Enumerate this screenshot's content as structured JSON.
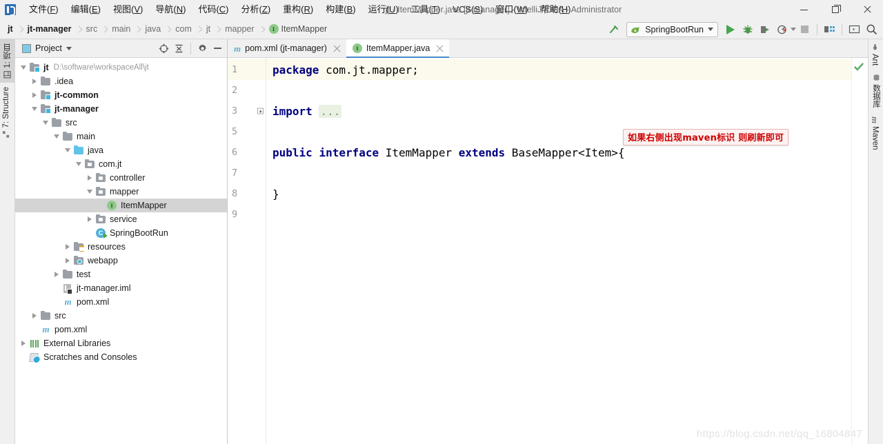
{
  "window": {
    "title": "jt - ItemMapper.java [jt-manager] - IntelliJ IDEA - Administrator",
    "minimize_label": "Minimize",
    "maximize_label": "Restore",
    "close_label": "Close"
  },
  "menubar": {
    "items": [
      {
        "label": "文件(F)",
        "mnemonic": "F"
      },
      {
        "label": "编辑(E)",
        "mnemonic": "E"
      },
      {
        "label": "视图(V)",
        "mnemonic": "V"
      },
      {
        "label": "导航(N)",
        "mnemonic": "N"
      },
      {
        "label": "代码(C)",
        "mnemonic": "C"
      },
      {
        "label": "分析(Z)",
        "mnemonic": "Z"
      },
      {
        "label": "重构(R)",
        "mnemonic": "R"
      },
      {
        "label": "构建(B)",
        "mnemonic": "B"
      },
      {
        "label": "运行(U)",
        "mnemonic": "U"
      },
      {
        "label": "工具(T)",
        "mnemonic": "T"
      },
      {
        "label": "VCS(S)",
        "mnemonic": "S"
      },
      {
        "label": "窗口(W)",
        "mnemonic": "W"
      },
      {
        "label": "帮助(H)",
        "mnemonic": "H"
      }
    ]
  },
  "breadcrumb": {
    "items": [
      {
        "label": "jt",
        "style": "bold"
      },
      {
        "label": "jt-manager",
        "style": "bold"
      },
      {
        "label": "src",
        "style": "muted"
      },
      {
        "label": "main",
        "style": "muted"
      },
      {
        "label": "java",
        "style": "muted"
      },
      {
        "label": "com",
        "style": "muted"
      },
      {
        "label": "jt",
        "style": "muted"
      },
      {
        "label": "mapper",
        "style": "muted"
      },
      {
        "label": "ItemMapper",
        "style": "normal",
        "icon": "interface-icon",
        "badge": "I"
      }
    ]
  },
  "toolbar": {
    "build_label": "Build",
    "run_config": {
      "name": "SpringBootRun",
      "icon": "spring-boot-icon"
    },
    "run_label": "Run",
    "debug_label": "Debug",
    "run_with_coverage_label": "Run with Coverage",
    "profile_label": "Profile",
    "stop_label": "Stop",
    "project_structure_label": "Project Structure",
    "terminal_label": "Terminal",
    "search_label": "Search Everywhere"
  },
  "left_rail": {
    "tabs": [
      {
        "label": "1: 项目",
        "icon": "project-icon",
        "active": true
      },
      {
        "label": "7: Structure",
        "icon": "structure-icon",
        "active": false
      }
    ]
  },
  "right_rail": {
    "tabs": [
      {
        "label": "Ant",
        "icon": "ant-icon"
      },
      {
        "label": "数据库",
        "icon": "database-icon"
      },
      {
        "label": "Maven",
        "icon": "maven-icon"
      }
    ]
  },
  "project_panel": {
    "title": "Project",
    "tools": [
      {
        "name": "select-opened-file",
        "label": "Select Opened File"
      },
      {
        "name": "collapse-all",
        "label": "Collapse All"
      },
      {
        "name": "settings",
        "label": "Settings"
      },
      {
        "name": "hide",
        "label": "Hide"
      }
    ],
    "tree": [
      {
        "indent": 0,
        "arrow": "down",
        "icon": "module-folder-icon",
        "label": "jt",
        "bold": true,
        "path": "D:\\software\\workspaceAll\\jt",
        "selected": false
      },
      {
        "indent": 1,
        "arrow": "right",
        "icon": "folder-icon",
        "label": ".idea",
        "bold": false,
        "selected": false
      },
      {
        "indent": 1,
        "arrow": "right",
        "icon": "module-folder-icon",
        "label": "jt-common",
        "bold": true,
        "selected": false
      },
      {
        "indent": 1,
        "arrow": "down",
        "icon": "module-folder-icon",
        "label": "jt-manager",
        "bold": true,
        "selected": false
      },
      {
        "indent": 2,
        "arrow": "down",
        "icon": "folder-icon",
        "label": "src",
        "bold": false,
        "selected": false
      },
      {
        "indent": 3,
        "arrow": "down",
        "icon": "folder-icon",
        "label": "main",
        "bold": false,
        "selected": false
      },
      {
        "indent": 4,
        "arrow": "down",
        "icon": "source-folder-icon",
        "label": "java",
        "bold": false,
        "selected": false
      },
      {
        "indent": 5,
        "arrow": "down",
        "icon": "package-icon",
        "label": "com.jt",
        "bold": false,
        "selected": false
      },
      {
        "indent": 6,
        "arrow": "right",
        "icon": "package-icon",
        "label": "controller",
        "bold": false,
        "selected": false
      },
      {
        "indent": 6,
        "arrow": "down",
        "icon": "package-icon",
        "label": "mapper",
        "bold": false,
        "selected": false
      },
      {
        "indent": 7,
        "arrow": "none",
        "icon": "interface-icon",
        "label": "ItemMapper",
        "bold": false,
        "selected": true
      },
      {
        "indent": 6,
        "arrow": "right",
        "icon": "package-icon",
        "label": "service",
        "bold": false,
        "selected": false
      },
      {
        "indent": 6,
        "arrow": "none",
        "icon": "runnable-class-icon",
        "label": "SpringBootRun",
        "bold": false,
        "selected": false
      },
      {
        "indent": 4,
        "arrow": "right",
        "icon": "resources-folder-icon",
        "label": "resources",
        "bold": false,
        "selected": false
      },
      {
        "indent": 4,
        "arrow": "right",
        "icon": "webapp-folder-icon",
        "label": "webapp",
        "bold": false,
        "selected": false
      },
      {
        "indent": 3,
        "arrow": "right",
        "icon": "folder-icon",
        "label": "test",
        "bold": false,
        "selected": false
      },
      {
        "indent": 3,
        "arrow": "none",
        "icon": "iml-file-icon",
        "label": "jt-manager.iml",
        "bold": false,
        "selected": false
      },
      {
        "indent": 3,
        "arrow": "none",
        "icon": "maven-file-icon",
        "label": "pom.xml",
        "bold": false,
        "selected": false
      },
      {
        "indent": 1,
        "arrow": "right",
        "icon": "folder-icon",
        "label": "src",
        "bold": false,
        "selected": false
      },
      {
        "indent": 1,
        "arrow": "none",
        "icon": "maven-file-icon",
        "label": "pom.xml",
        "bold": false,
        "selected": false
      },
      {
        "indent": 0,
        "arrow": "right",
        "icon": "libraries-icon",
        "label": "External Libraries",
        "bold": false,
        "selected": false
      },
      {
        "indent": 0,
        "arrow": "none",
        "icon": "scratches-icon",
        "label": "Scratches and Consoles",
        "bold": false,
        "selected": false
      }
    ]
  },
  "editor": {
    "tabs": [
      {
        "label": "pom.xml (jt-manager)",
        "icon": "maven-file-icon",
        "active": false
      },
      {
        "label": "ItemMapper.java",
        "icon": "interface-icon",
        "active": true
      }
    ],
    "line_numbers": [
      "1",
      "2",
      "3",
      "5",
      "6",
      "7",
      "8",
      "9"
    ],
    "lines": [
      {
        "num": "1",
        "current": true,
        "fold": false,
        "tokens": [
          {
            "t": "package",
            "k": "kw"
          },
          {
            "t": " com.jt.mapper;",
            "k": "plain"
          }
        ]
      },
      {
        "num": "2",
        "current": false,
        "fold": false,
        "tokens": []
      },
      {
        "num": "3",
        "current": false,
        "fold": true,
        "tokens": [
          {
            "t": "import",
            "k": "kw"
          },
          {
            "t": " ",
            "k": "plain"
          },
          {
            "t": "...",
            "k": "fold"
          }
        ]
      },
      {
        "num": "5",
        "current": false,
        "fold": false,
        "tokens": []
      },
      {
        "num": "6",
        "current": false,
        "fold": false,
        "tokens": [
          {
            "t": "public",
            "k": "kw"
          },
          {
            "t": " ",
            "k": "plain"
          },
          {
            "t": "interface",
            "k": "kw"
          },
          {
            "t": " ItemMapper ",
            "k": "plain"
          },
          {
            "t": "extends",
            "k": "kw"
          },
          {
            "t": " BaseMapper<Item>{",
            "k": "plain"
          }
        ]
      },
      {
        "num": "7",
        "current": false,
        "fold": false,
        "tokens": []
      },
      {
        "num": "8",
        "current": false,
        "fold": false,
        "tokens": [
          {
            "t": "}",
            "k": "plain"
          }
        ]
      },
      {
        "num": "9",
        "current": false,
        "fold": false,
        "tokens": []
      }
    ],
    "inspection_status": "ok",
    "annotation": {
      "text": "如果右侧出现maven标识 则刷新即可",
      "color": "#cc0000",
      "background": "#fdf2f2"
    }
  },
  "watermark": {
    "text": "https://blog.csdn.net/qq_16804847"
  },
  "colors": {
    "accent": "#4387c7",
    "run_green": "#49a54a",
    "selection": "#d4d4d4",
    "caret_row": "#fcfaec",
    "keyword": "#000080",
    "chrome": "#f0f0f0"
  }
}
